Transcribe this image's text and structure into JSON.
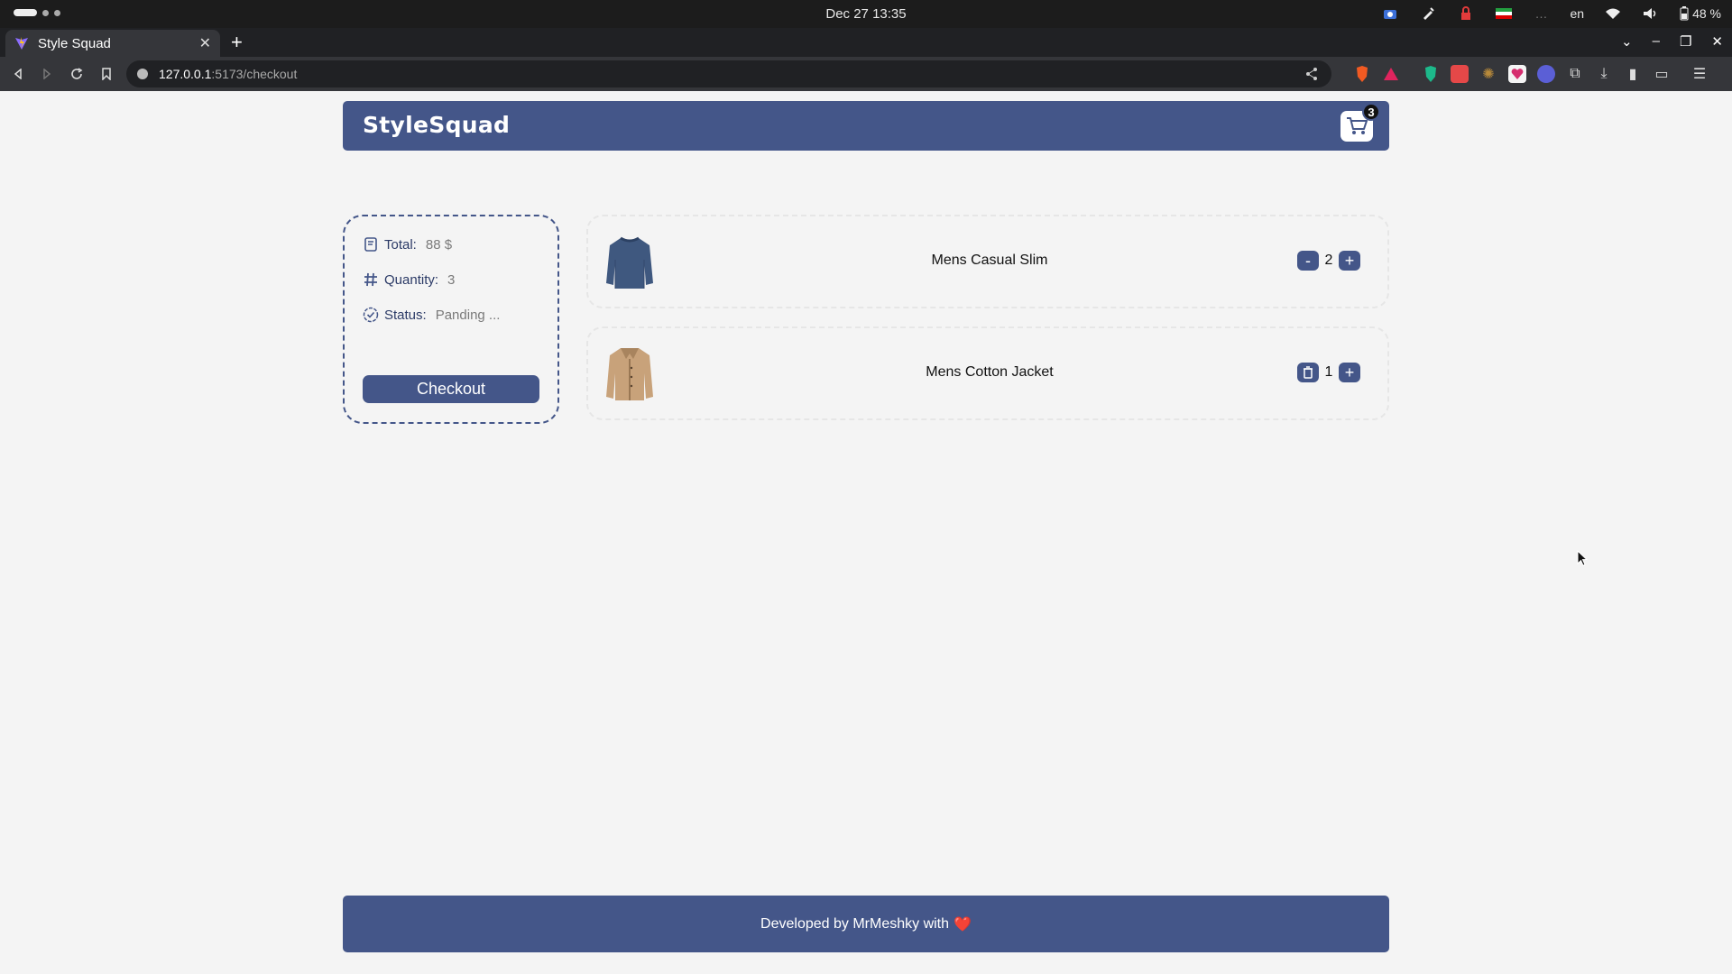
{
  "os": {
    "clock": "Dec 27  13:35",
    "lang": "en",
    "battery": "48 %"
  },
  "browser": {
    "tab_title": "Style Squad",
    "url_host": "127.0.0.1",
    "url_path": ":5173/checkout"
  },
  "header": {
    "brand": "StyleSquad",
    "cart_count": "3"
  },
  "summary": {
    "total_label": "Total:",
    "total_value": "88 $",
    "quantity_label": "Quantity:",
    "quantity_value": "3",
    "status_label": "Status:",
    "status_value": "Panding ...",
    "checkout_label": "Checkout"
  },
  "cart_items": [
    {
      "name": "Mens Casual Slim",
      "quantity": "2",
      "decrement_label": "-",
      "increment_label": "+"
    },
    {
      "name": "Mens Cotton Jacket",
      "quantity": "1",
      "increment_label": "+"
    }
  ],
  "footer": {
    "text": "Developed by MrMeshky with",
    "heart": "❤️"
  },
  "colors": {
    "accent": "#445689",
    "page_bg": "#f4f4f4"
  }
}
